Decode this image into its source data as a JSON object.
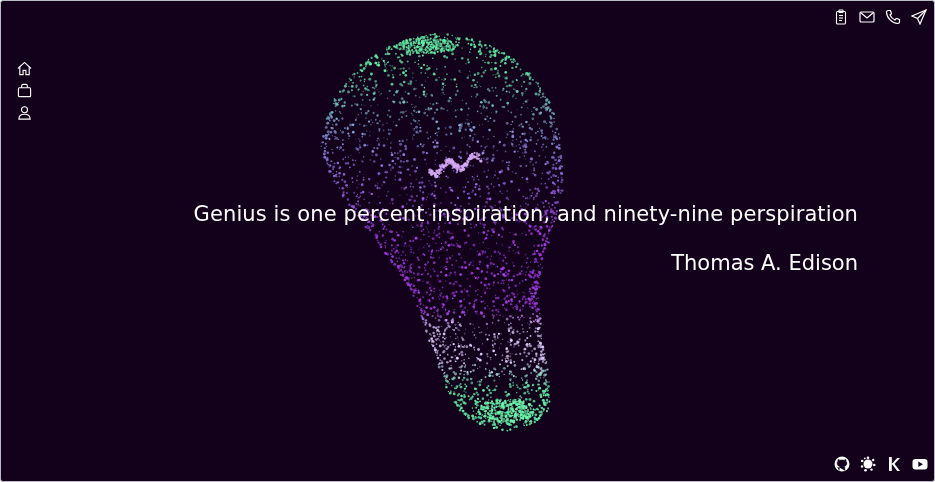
{
  "quote": {
    "text": "Genius is one percent inspiration, and ninety-nine perspiration",
    "author": "Thomas A. Edison"
  }
}
